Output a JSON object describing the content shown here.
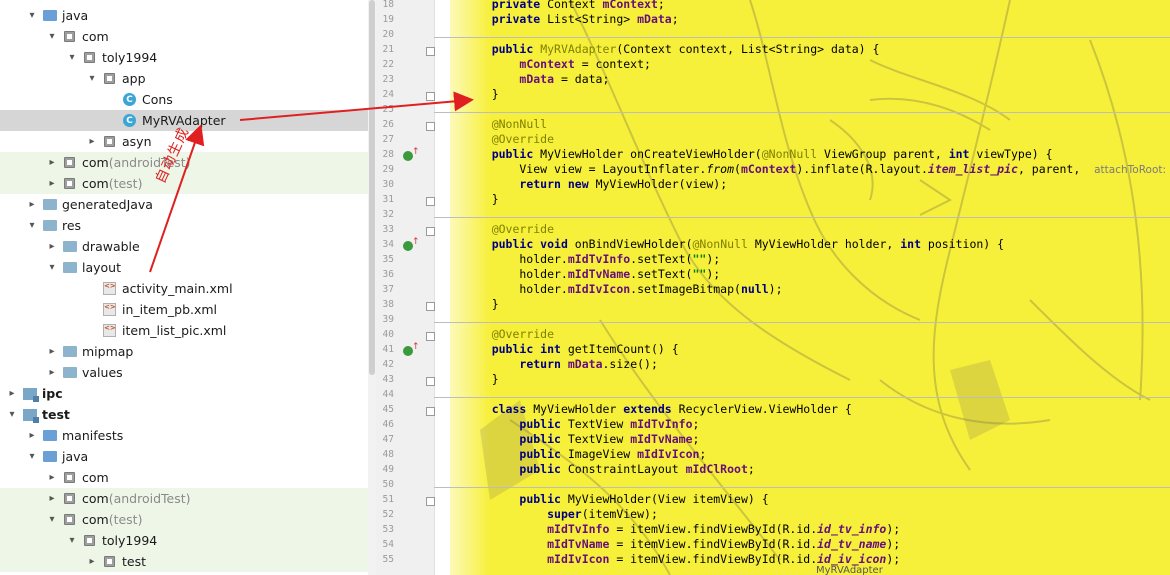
{
  "tree": {
    "items": [
      {
        "label": "java",
        "indent": 1,
        "arrow": "down",
        "icon": "folder-blue"
      },
      {
        "label": "com",
        "indent": 2,
        "arrow": "down",
        "icon": "package"
      },
      {
        "label": "toly1994",
        "indent": 3,
        "arrow": "down",
        "icon": "package"
      },
      {
        "label": "app",
        "indent": 4,
        "arrow": "down",
        "icon": "package"
      },
      {
        "label": "Cons",
        "indent": 5,
        "arrow": "",
        "icon": "class"
      },
      {
        "label": "MyRVAdapter",
        "indent": 5,
        "arrow": "",
        "icon": "class",
        "selected": true
      },
      {
        "label": "asyn",
        "indent": 4,
        "arrow": "right",
        "icon": "package"
      },
      {
        "label": "com",
        "suffix": "(androidTest)",
        "indent": 2,
        "arrow": "right",
        "icon": "package",
        "green": true
      },
      {
        "label": "com",
        "suffix": "(test)",
        "indent": 2,
        "arrow": "right",
        "icon": "package",
        "green": true
      },
      {
        "label": "generatedJava",
        "indent": 1,
        "arrow": "right",
        "icon": "folder-gen"
      },
      {
        "label": "res",
        "indent": 1,
        "arrow": "down",
        "icon": "folder-res"
      },
      {
        "label": "drawable",
        "indent": 2,
        "arrow": "right",
        "icon": "folder"
      },
      {
        "label": "layout",
        "indent": 2,
        "arrow": "down",
        "icon": "folder"
      },
      {
        "label": "activity_main.xml",
        "indent": 4,
        "arrow": "",
        "icon": "xml"
      },
      {
        "label": "in_item_pb.xml",
        "indent": 4,
        "arrow": "",
        "icon": "xml"
      },
      {
        "label": "item_list_pic.xml",
        "indent": 4,
        "arrow": "",
        "icon": "xml"
      },
      {
        "label": "mipmap",
        "indent": 2,
        "arrow": "right",
        "icon": "folder"
      },
      {
        "label": "values",
        "indent": 2,
        "arrow": "right",
        "icon": "folder"
      },
      {
        "label": "ipc",
        "indent": 0,
        "arrow": "right",
        "icon": "module",
        "bold": true
      },
      {
        "label": "test",
        "indent": 0,
        "arrow": "down",
        "icon": "module",
        "bold": true
      },
      {
        "label": "manifests",
        "indent": 1,
        "arrow": "right",
        "icon": "folder-blue"
      },
      {
        "label": "java",
        "indent": 1,
        "arrow": "down",
        "icon": "folder-blue"
      },
      {
        "label": "com",
        "indent": 2,
        "arrow": "right",
        "icon": "package"
      },
      {
        "label": "com",
        "suffix": "(androidTest)",
        "indent": 2,
        "arrow": "right",
        "icon": "package",
        "green": true
      },
      {
        "label": "com",
        "suffix": "(test)",
        "indent": 2,
        "arrow": "down",
        "icon": "package",
        "green": true
      },
      {
        "label": "toly1994",
        "indent": 3,
        "arrow": "down",
        "icon": "package",
        "green": true
      },
      {
        "label": "test",
        "indent": 4,
        "arrow": "right",
        "icon": "package",
        "green": true
      }
    ]
  },
  "editor": {
    "lines": [
      {
        "n": "18",
        "html": "    <span class='kw'>private</span> Context <span class='fld'>mContext</span>;"
      },
      {
        "n": "19",
        "html": "    <span class='kw'>private</span> List&lt;String&gt; <span class='fld'>mData</span>;"
      },
      {
        "n": "20",
        "html": ""
      },
      {
        "n": "21",
        "html": "    <span class='kw'>public</span> <span class='ann'>MyRVAdapter</span>(Context context, List&lt;String&gt; data) {"
      },
      {
        "n": "22",
        "html": "        <span class='fld'>mContext</span> = context;"
      },
      {
        "n": "23",
        "html": "        <span class='fld'>mData</span> = data;"
      },
      {
        "n": "24",
        "html": "    }"
      },
      {
        "n": "25",
        "html": ""
      },
      {
        "n": "26",
        "html": "    <span class='ann'>@NonNull</span>"
      },
      {
        "n": "27",
        "html": "    <span class='ann'>@Override</span>"
      },
      {
        "n": "28",
        "html": "    <span class='kw'>public</span> MyViewHolder onCreateViewHolder(<span class='ann'>@NonNull</span> ViewGroup parent, <span class='kw'>int</span> viewType) {"
      },
      {
        "n": "29",
        "html": "        View view = LayoutInflater.<span class='it'>from</span>(<span class='fld'>mContext</span>).inflate(R.layout.<span class='fld it'>item_list_pic</span>, parent,  <span class='hint'>attachToRoot:</span> <span class='kw'>false</span>);"
      },
      {
        "n": "30",
        "html": "        <span class='kw'>return new</span> MyViewHolder(view);"
      },
      {
        "n": "31",
        "html": "    }"
      },
      {
        "n": "32",
        "html": ""
      },
      {
        "n": "33",
        "html": "    <span class='ann'>@Override</span>"
      },
      {
        "n": "34",
        "html": "    <span class='kw'>public void</span> onBindViewHolder(<span class='ann'>@NonNull</span> MyViewHolder holder, <span class='kw'>int</span> position) {"
      },
      {
        "n": "35",
        "html": "        holder.<span class='fld'>mIdTvInfo</span>.setText(<span class='str'>\"\"</span>);"
      },
      {
        "n": "36",
        "html": "        holder.<span class='fld'>mIdTvName</span>.setText(<span class='str'>\"\"</span>);"
      },
      {
        "n": "37",
        "html": "        holder.<span class='fld'>mIdIvIcon</span>.setImageBitmap(<span class='kw'>null</span>);"
      },
      {
        "n": "38",
        "html": "    }"
      },
      {
        "n": "39",
        "html": ""
      },
      {
        "n": "40",
        "html": "    <span class='ann'>@Override</span>"
      },
      {
        "n": "41",
        "html": "    <span class='kw'>public int</span> getItemCount() {"
      },
      {
        "n": "42",
        "html": "        <span class='kw'>return</span> <span class='fld'>mData</span>.size();"
      },
      {
        "n": "43",
        "html": "    }"
      },
      {
        "n": "44",
        "html": ""
      },
      {
        "n": "45",
        "html": "    <span class='kw'>class</span> MyViewHolder <span class='kw'>extends</span> RecyclerView.ViewHolder {"
      },
      {
        "n": "46",
        "html": "        <span class='kw'>public</span> TextView <span class='fld'>mIdTvInfo</span>;"
      },
      {
        "n": "47",
        "html": "        <span class='kw'>public</span> TextView <span class='fld'>mIdTvName</span>;"
      },
      {
        "n": "48",
        "html": "        <span class='kw'>public</span> ImageView <span class='fld'>mIdIvIcon</span>;"
      },
      {
        "n": "49",
        "html": "        <span class='kw'>public</span> ConstraintLayout <span class='fld'>mIdClRoot</span>;"
      },
      {
        "n": "50",
        "html": ""
      },
      {
        "n": "51",
        "html": "        <span class='kw'>public</span> MyViewHolder(View itemView) {"
      },
      {
        "n": "52",
        "html": "            <span class='kw'>super</span>(itemView);"
      },
      {
        "n": "53",
        "html": "            <span class='fld'>mIdTvInfo</span> = itemView.findViewById(R.id.<span class='fld it'>id_tv_info</span>);"
      },
      {
        "n": "54",
        "html": "            <span class='fld'>mIdTvName</span> = itemView.findViewById(R.id.<span class='fld it'>id_tv_name</span>);"
      },
      {
        "n": "55",
        "html": "            <span class='fld'>mIdIvIcon</span> = itemView.findViewById(R.id.<span class='fld it'>id_iv_icon</span>);"
      }
    ],
    "bottom_tab": "MyRVAdapter"
  },
  "annotation": {
    "text": "自动生成",
    "color": "#e02020"
  }
}
